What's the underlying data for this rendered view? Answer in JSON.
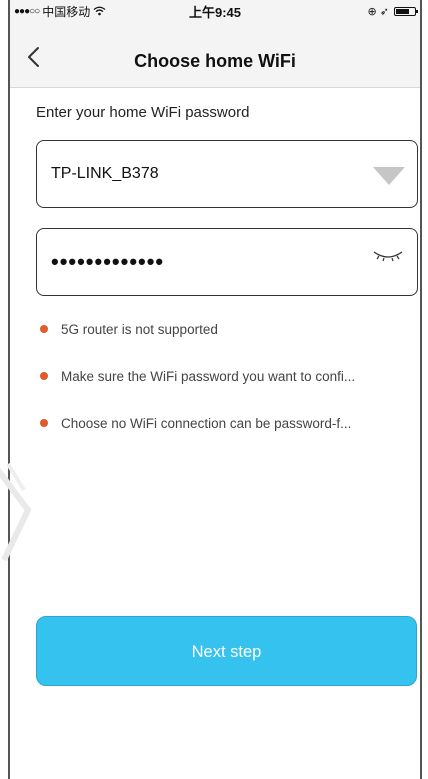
{
  "statusbar": {
    "carrier": "中国移动",
    "signal": "●●●○○",
    "time": "上午9:45",
    "right_icons": "⊕ ➶"
  },
  "navbar": {
    "title": "Choose home WiFi"
  },
  "form": {
    "instruction": "Enter your home WiFi password",
    "ssid_value": "TP-LINK_B378",
    "password_value": "•••••••••••••"
  },
  "tips": [
    "5G router is not supported",
    "Make sure the WiFi password you want to confi...",
    "Choose no WiFi connection can be password-f..."
  ],
  "actions": {
    "next_label": "Next step"
  },
  "colors": {
    "accent": "#35c2ef",
    "tip_dot": "#e05a2c",
    "border": "#333333"
  },
  "icons": {
    "back": "chevron-left-icon",
    "dropdown": "triangle-down-icon",
    "visibility": "eye-closed-icon",
    "wifi": "wifi-icon",
    "battery": "battery-icon"
  }
}
